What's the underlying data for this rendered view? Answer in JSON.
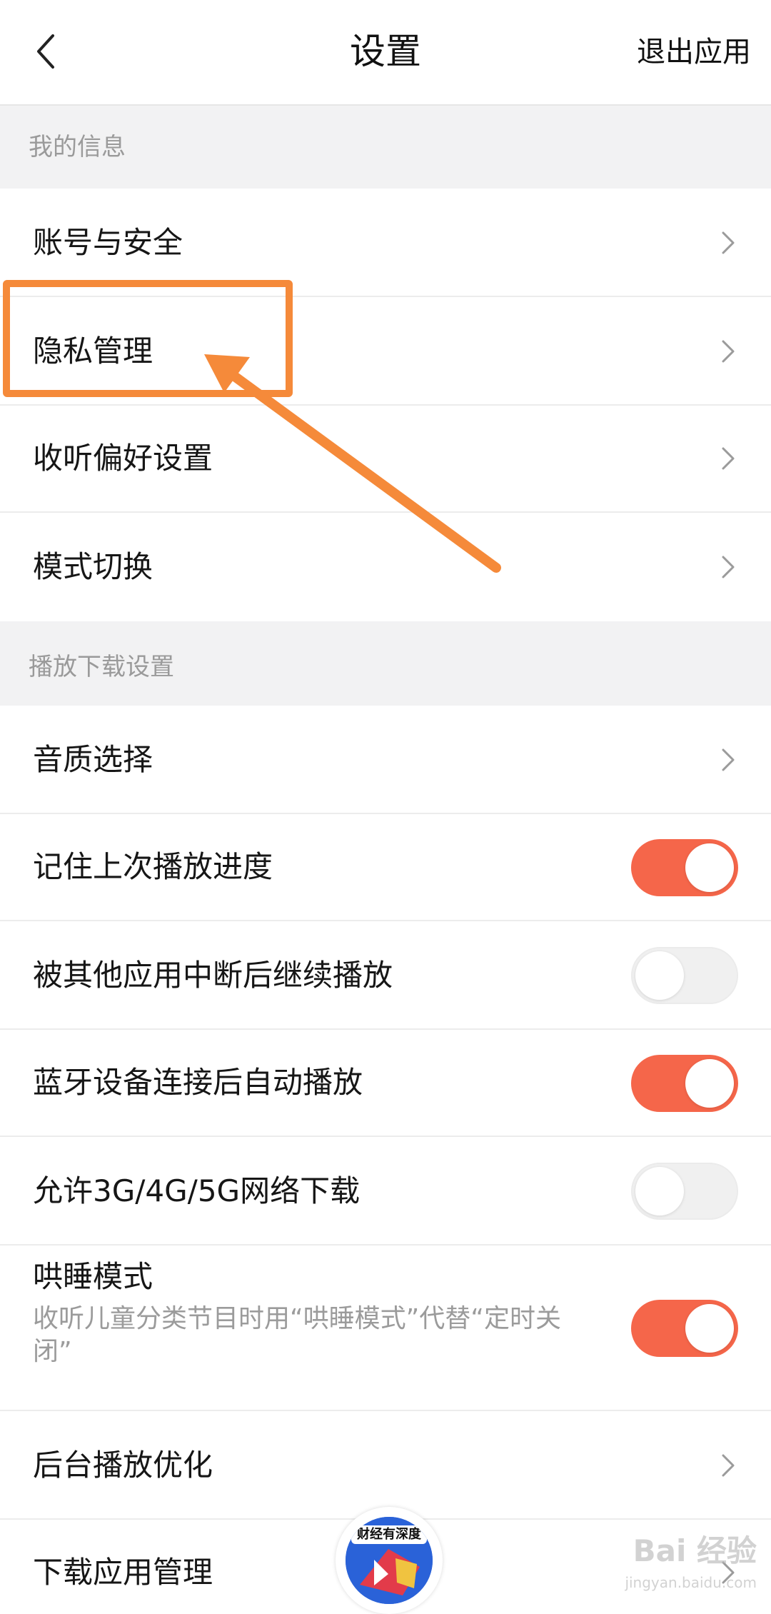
{
  "header": {
    "title": "设置",
    "exit_label": "退出应用",
    "back_icon": "chevron-left-icon"
  },
  "sections": [
    {
      "title": "我的信息",
      "items": [
        {
          "label": "账号与安全",
          "control": "chevron"
        },
        {
          "label": "隐私管理",
          "control": "chevron"
        },
        {
          "label": "收听偏好设置",
          "control": "chevron"
        },
        {
          "label": "模式切换",
          "control": "chevron"
        }
      ]
    },
    {
      "title": "播放下载设置",
      "items": [
        {
          "label": "音质选择",
          "control": "chevron"
        },
        {
          "label": "记住上次播放进度",
          "control": "toggle",
          "on": true
        },
        {
          "label": "被其他应用中断后继续播放",
          "control": "toggle",
          "on": false
        },
        {
          "label": "蓝牙设备连接后自动播放",
          "control": "toggle",
          "on": true
        },
        {
          "label": "允许3G/4G/5G网络下载",
          "control": "toggle",
          "on": false
        },
        {
          "label": "哄睡模式",
          "subtext": "收听儿童分类节目时用“哄睡模式”代替“定时关闭”",
          "control": "toggle",
          "on": true
        },
        {
          "label": "后台播放优化",
          "control": "chevron"
        },
        {
          "label": "下载应用管理",
          "control": "chevron"
        }
      ]
    }
  ],
  "player": {
    "badge_text": "财经有深度"
  },
  "watermark": {
    "text": "Bai 经验",
    "url": "jingyan.baidu.com"
  },
  "colors": {
    "toggle_on": "#f5664a",
    "annotation": "#f58a3a",
    "section_bg": "#f2f2f3"
  }
}
